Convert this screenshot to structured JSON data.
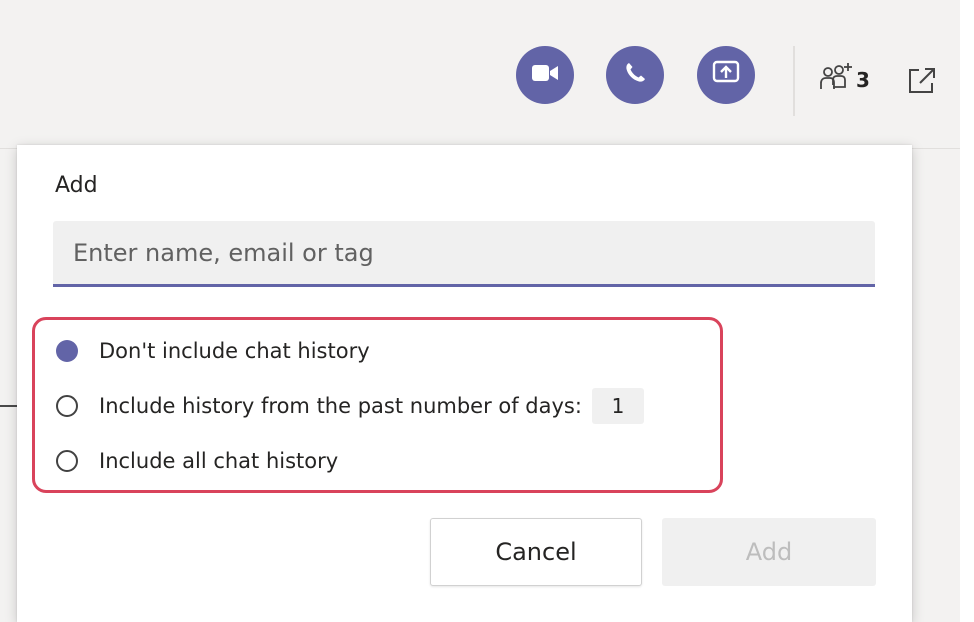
{
  "colors": {
    "accent": "#6264a7",
    "highlight": "#d9435b"
  },
  "toolbar": {
    "video_call_icon": "video-camera-icon",
    "audio_call_icon": "phone-icon",
    "share_screen_icon": "share-screen-icon",
    "participants_icon": "people-add-icon",
    "participants_count": "3",
    "popout_icon": "popout-icon"
  },
  "dialog": {
    "add_label": "Add",
    "search_placeholder": "Enter name, email or tag",
    "history_options": [
      {
        "label": "Don't include chat history",
        "selected": true
      },
      {
        "label": "Include history from the past number of days:",
        "selected": false,
        "days_value": "1"
      },
      {
        "label": "Include all chat history",
        "selected": false
      }
    ],
    "cancel_label": "Cancel",
    "add_button_label": "Add"
  }
}
